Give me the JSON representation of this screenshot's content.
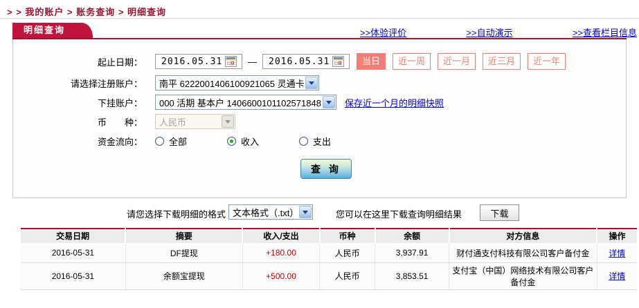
{
  "breadcrumb": {
    "text": "> > 我的账户 > 账务查询 > 明细查询"
  },
  "tab": {
    "label": "明细查询"
  },
  "top_links": [
    {
      "label": ">>体验评价"
    },
    {
      "label": ">>自动演示"
    },
    {
      "label": ">>查看栏目信息"
    }
  ],
  "form": {
    "date_label": "起止日期：",
    "date_from": "2016.05.31",
    "date_to": "2016.05.31",
    "date_separator": "—",
    "quick_buttons": [
      {
        "label": "当日",
        "active": true
      },
      {
        "label": "近一周",
        "active": false
      },
      {
        "label": "近一月",
        "active": false
      },
      {
        "label": "近三月",
        "active": false
      },
      {
        "label": "近一年",
        "active": false
      }
    ],
    "account_label": "请选择注册账户：",
    "account_value": "南平 6222001406100921065 灵通卡",
    "sub_account_label": "下挂账户：",
    "sub_account_value": "000 活期 基本户 1406600101102571848",
    "snapshot_link": "保存近一个月的明细快照",
    "currency_label": "币　　种：",
    "currency_value": "人民币",
    "flow_label": "资金流向：",
    "flow_options": [
      {
        "label": "全部",
        "checked": false
      },
      {
        "label": "收入",
        "checked": true
      },
      {
        "label": "支出",
        "checked": false
      }
    ],
    "query_button": "查 询"
  },
  "download": {
    "format_label": "请您选择下载明细的格式",
    "format_value": "文本格式（.txt）",
    "result_hint": "您可以在这里下载查询明细结果",
    "download_button": "下载"
  },
  "table": {
    "headers": [
      "交易日期",
      "摘要",
      "收入/支出",
      "币种",
      "余额",
      "对方信息",
      "操作"
    ],
    "rows": [
      {
        "date": "2016-05-31",
        "summary": "DF提现",
        "amount": "+180.00",
        "currency": "人民币",
        "balance": "3,937.91",
        "counterparty": "财付通支付科技有限公司客户备付金",
        "action": "详情"
      },
      {
        "date": "2016-05-31",
        "summary": "余额宝提现",
        "amount": "+500.00",
        "currency": "人民币",
        "balance": "3,853.51",
        "counterparty": "支付宝（中国）网络技术有限公司客户备付金",
        "action": "详情"
      }
    ]
  },
  "colors": {
    "accent_red": "#9c1432",
    "tab_red": "#c0143c",
    "pink_button": "#f57d76",
    "link_blue": "#0000cc",
    "amount_red": "#cc0000"
  }
}
